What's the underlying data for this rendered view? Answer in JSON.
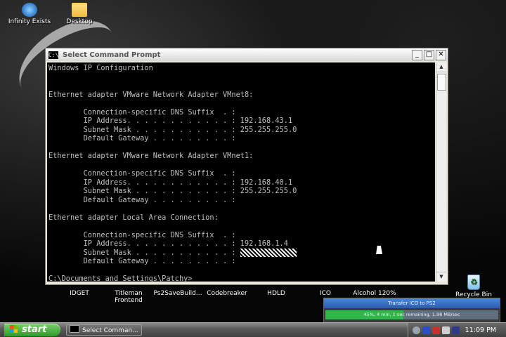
{
  "desktop_icons": [
    {
      "label": "Infinity Exists"
    },
    {
      "label": "Desktop"
    }
  ],
  "bottom_icons": [
    {
      "label": "IDGET"
    },
    {
      "label": "Titleman Frontend"
    },
    {
      "label": "Ps2SaveBuild..."
    },
    {
      "label": "Codebreaker"
    },
    {
      "label": "HDLD"
    },
    {
      "label": "ICO"
    },
    {
      "label": "Alcohol 120%"
    },
    {
      "label": "Recycle Bin"
    }
  ],
  "window": {
    "title": "Select Command Prompt",
    "buttons": {
      "minimize": "_",
      "maximize": "□",
      "close": "✕"
    },
    "icon_text": "C:\\"
  },
  "console_lines": [
    "Windows IP Configuration",
    "",
    "",
    "Ethernet adapter VMware Network Adapter VMnet8:",
    "",
    "        Connection-specific DNS Suffix  . :",
    "        IP Address. . . . . . . . . . . . : 192.168.43.1",
    "        Subnet Mask . . . . . . . . . . . : 255.255.255.0",
    "        Default Gateway . . . . . . . . . :",
    "",
    "Ethernet adapter VMware Network Adapter VMnet1:",
    "",
    "        Connection-specific DNS Suffix  . :",
    "        IP Address. . . . . . . . . . . . : 192.168.40.1",
    "        Subnet Mask . . . . . . . . . . . : 255.255.255.0",
    "        Default Gateway . . . . . . . . . :",
    "",
    "Ethernet adapter Local Area Connection:",
    "",
    "        Connection-specific DNS Suffix  . :",
    "        IP Address. . . . . . . . . . . . : 192.168.1.4",
    "        Subnet Mask . . . . . . . . . . . : ",
    "        Default Gateway . . . . . . . . . :",
    "",
    "C:\\Documents and Settings\\Patchy>"
  ],
  "transfer": {
    "title": "Transfer ICO to PS2",
    "status": "45%, 4 min, 1 sec remaining, 1.98 MB/sec",
    "progress_percent": 45
  },
  "taskbar": {
    "start_label": "start",
    "task_item": "Select Comman...",
    "clock": "11:09 PM"
  },
  "colors": {
    "console_bg": "#000000",
    "console_fg": "#c0c0c0",
    "start_green": "#2f9a2a",
    "progress_green": "#2fb84a"
  }
}
